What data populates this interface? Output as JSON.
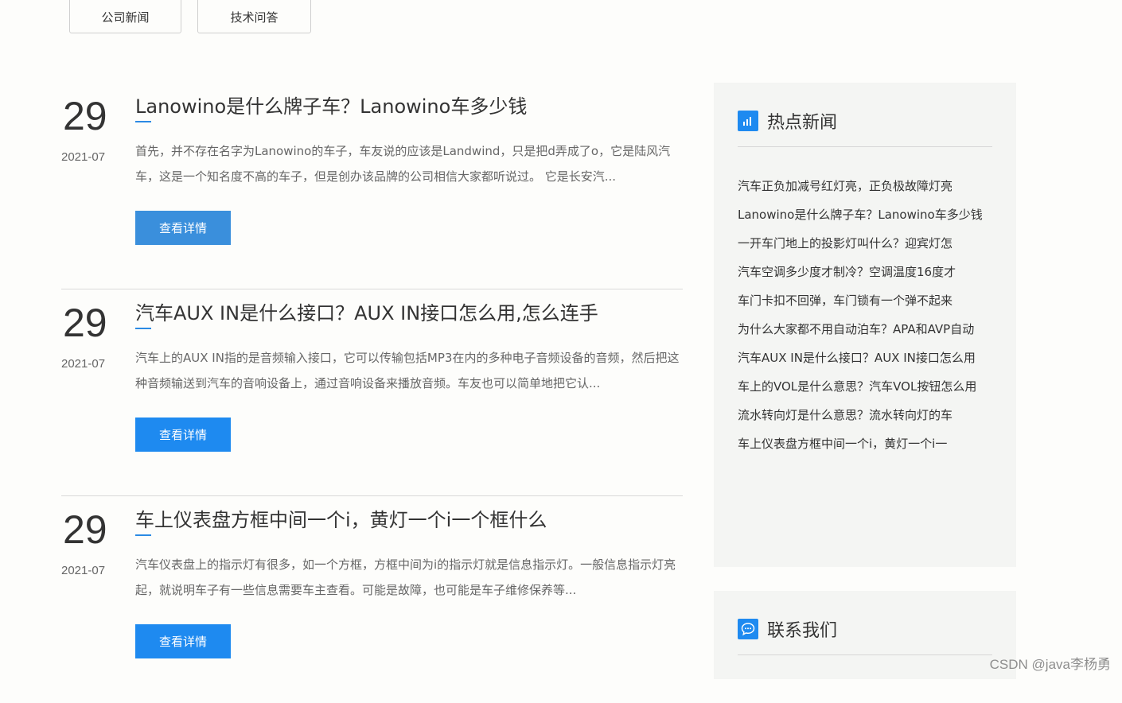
{
  "tabs": [
    {
      "label": "公司新闻"
    },
    {
      "label": "技术问答"
    }
  ],
  "articles": [
    {
      "day": "29",
      "year_month": "2021-07",
      "title": "Lanowino是什么牌子车？Lanowino车多少钱",
      "summary": "首先，并不存在名字为Lanowino的车子，车友说的应该是Landwind，只是把d弄成了o，它是陆风汽车，这是一个知名度不高的车子，但是创办该品牌的公司相信大家都听说过。 它是长安汽...",
      "button": "查看详情"
    },
    {
      "day": "29",
      "year_month": "2021-07",
      "title": "汽车AUX IN是什么接口？AUX IN接口怎么用,怎么连手",
      "summary": "汽车上的AUX IN指的是音频输入接口，它可以传输包括MP3在内的多种电子音频设备的音频，然后把这种音频输送到汽车的音响设备上，通过音响设备来播放音频。车友也可以简单地把它认...",
      "button": "查看详情"
    },
    {
      "day": "29",
      "year_month": "2021-07",
      "title": "车上仪表盘方框中间一个i，黄灯一个i一个框什么",
      "summary": "汽车仪表盘上的指示灯有很多，如一个方框，方框中间为i的指示灯就是信息指示灯。一般信息指示灯亮起，就说明车子有一些信息需要车主查看。可能是故障，也可能是车子维修保养等...",
      "button": "查看详情"
    }
  ],
  "sidebar": {
    "hot": {
      "title": "热点新闻",
      "icon": "bar-chart-icon",
      "items": [
        "汽车正负加减号红灯亮，正负极故障灯亮",
        "Lanowino是什么牌子车？Lanowino车多少钱",
        "一开车门地上的投影灯叫什么？迎宾灯怎",
        "汽车空调多少度才制冷？空调温度16度才",
        "车门卡扣不回弹，车门锁有一个弹不起来",
        "为什么大家都不用自动泊车？APA和AVP自动",
        "汽车AUX IN是什么接口？AUX IN接口怎么用",
        "车上的VOL是什么意思？汽车VOL按钮怎么用",
        "流水转向灯是什么意思？流水转向灯的车",
        "车上仪表盘方框中间一个i，黄灯一个i一"
      ]
    },
    "contact": {
      "title": "联系我们",
      "icon": "chat-bubble-icon"
    }
  },
  "watermark": "CSDN @java李杨勇",
  "colors": {
    "accent": "#1e8af0",
    "panel_bg": "#f4f5f3",
    "page_bg": "#fdfdfb"
  }
}
